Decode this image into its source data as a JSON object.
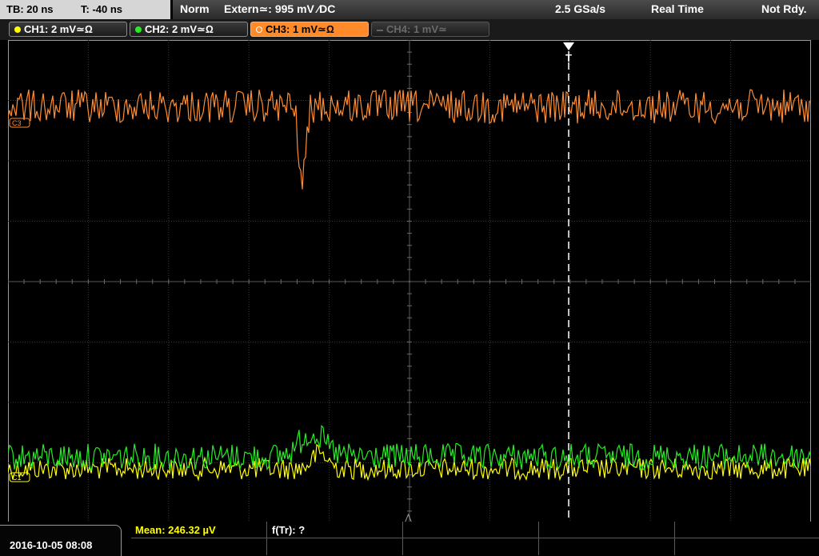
{
  "status": {
    "timebase": "TB: 20 ns",
    "trigger_time": "T: -40 ns",
    "mode": "Norm",
    "trigger_source": "Extern≃: 995 mV ∕DC",
    "sample_rate": "2.5 GSa/s",
    "acq_mode": "Real Time",
    "trigger_state": "Not Rdy."
  },
  "channels": [
    {
      "label": "CH1: 2 mV≃Ω",
      "color": "#ffff00",
      "state": "on"
    },
    {
      "label": "CH2: 2 mV≃Ω",
      "color": "#22ee22",
      "state": "on"
    },
    {
      "label": "CH3: 1 mV≃Ω",
      "color": "#ff8c30",
      "state": "active"
    },
    {
      "label": "CH4: 1 mV≃",
      "color": "#666666",
      "state": "off"
    }
  ],
  "markers": {
    "trigger": "T",
    "ch3": "C3",
    "ch1": "C1"
  },
  "waveforms": {
    "ch3": {
      "color": "#ff8c30",
      "baseline_div": 1.1,
      "noise_div": 0.28,
      "dip_div": -1.3
    },
    "ch2": {
      "color": "#22ee22",
      "baseline_div": 6.9,
      "noise_div": 0.22,
      "bump_div": 0.4
    },
    "ch1": {
      "color": "#ffff00",
      "baseline_div": 7.1,
      "noise_div": 0.18,
      "bump_div": 0.25
    }
  },
  "footer": {
    "datetime": "2016-10-05 08:08",
    "mean_label": "Mean: 246.32 µV",
    "ftr_label": "f(Tr): ?"
  }
}
